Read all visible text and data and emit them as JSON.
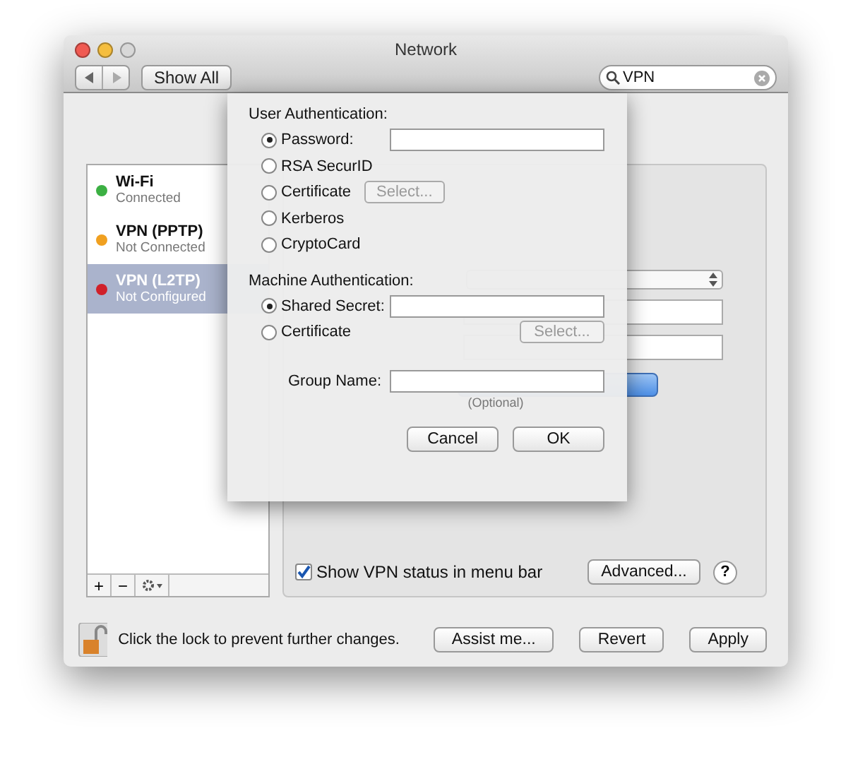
{
  "window": {
    "title": "Network"
  },
  "toolbar": {
    "show_all": "Show All",
    "search": {
      "value": "VPN"
    }
  },
  "services": [
    {
      "name": "Wi-Fi",
      "status": "Connected",
      "color": "#3cb043",
      "selected": false
    },
    {
      "name": "VPN (PPTP)",
      "status": "Not Connected",
      "color": "#f0a020",
      "selected": false
    },
    {
      "name": "VPN (L2TP)",
      "status": "Not Configured",
      "color": "#d0202a",
      "selected": true
    }
  ],
  "list_buttons": [
    "+",
    "−"
  ],
  "panel": {
    "show_status": {
      "label": "Show VPN status in menu bar",
      "checked": true
    },
    "advanced": "Advanced...",
    "help": "?"
  },
  "footer": {
    "lock_text": "Click the lock to prevent further changes.",
    "buttons": [
      "Assist me...",
      "Revert",
      "Apply"
    ]
  },
  "sheet": {
    "groups": [
      {
        "heading": "User Authentication:",
        "options": [
          {
            "label": "Password:",
            "selected": true,
            "kind": "field"
          },
          {
            "label": "RSA SecurID",
            "selected": false,
            "kind": "plain"
          },
          {
            "label": "Certificate",
            "selected": false,
            "kind": "button",
            "button": "Select...",
            "disabled": true
          },
          {
            "label": "Kerberos",
            "selected": false,
            "kind": "plain"
          },
          {
            "label": "CryptoCard",
            "selected": false,
            "kind": "plain"
          }
        ]
      },
      {
        "heading": "Machine Authentication:",
        "options": [
          {
            "label": "Shared Secret:",
            "selected": true,
            "kind": "field"
          },
          {
            "label": "Certificate",
            "selected": false,
            "kind": "button_right",
            "button": "Select...",
            "disabled": true
          }
        ]
      }
    ],
    "group_name": {
      "label": "Group Name:",
      "hint": "(Optional)"
    },
    "buttons": [
      "Cancel",
      "OK"
    ]
  }
}
